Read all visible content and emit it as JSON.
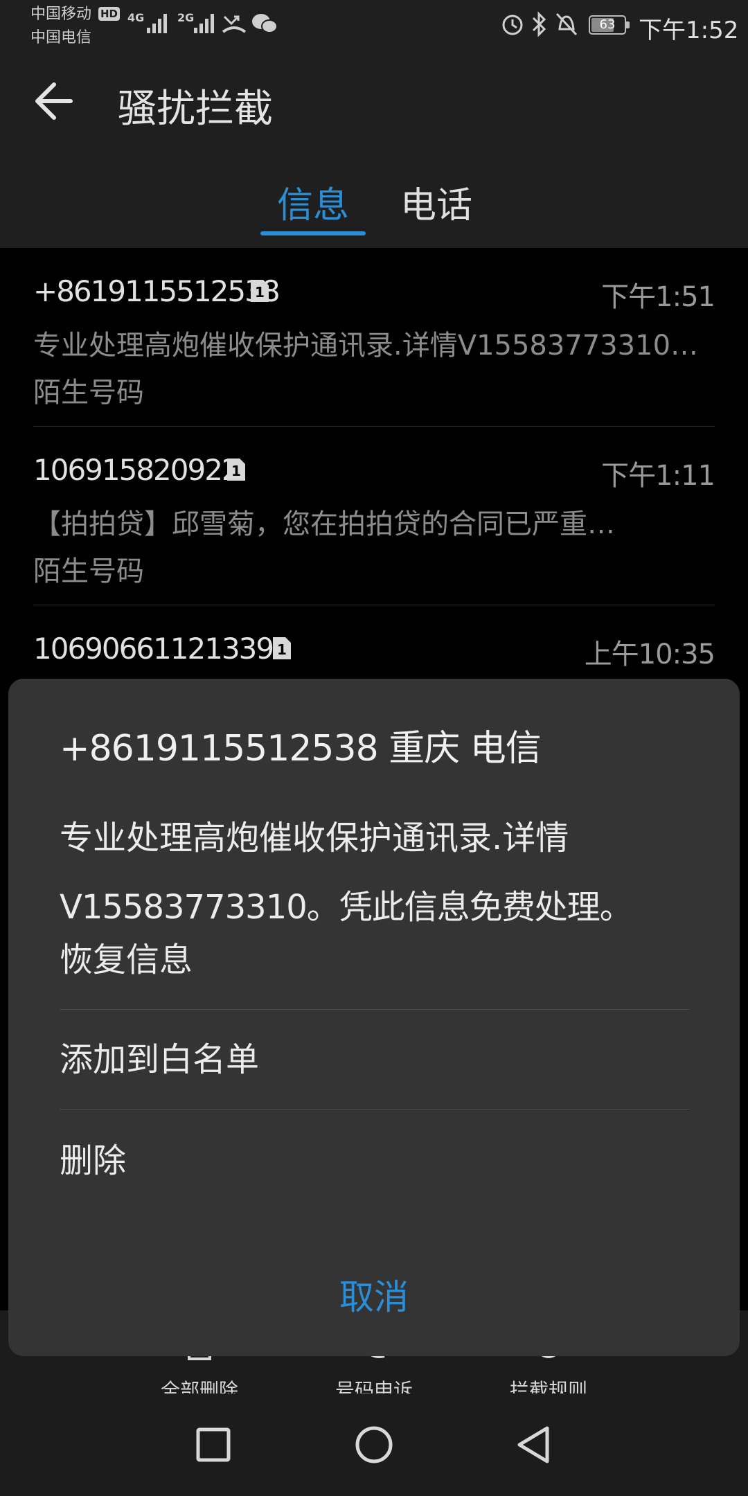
{
  "status_bar": {
    "carrier_1": "中国移动",
    "carrier_2": "中国电信",
    "hd_badge": "HD",
    "network_1": "4G",
    "network_2": "2G",
    "battery": "63",
    "time": "下午1:52"
  },
  "header": {
    "title": "骚扰拦截",
    "tabs": [
      {
        "label": "信息",
        "active": true
      },
      {
        "label": "电话",
        "active": false
      }
    ]
  },
  "messages": [
    {
      "sender": "+8619115512538",
      "time": "下午1:51",
      "preview": "专业处理高炮催收保护通讯录.详情V15583773310…",
      "tag": "陌生号码"
    },
    {
      "sender": "106915820922",
      "time": "下午1:11",
      "preview": "【拍拍贷】邱雪菊，您在拍拍贷的合同已严重…",
      "tag": "陌生号码"
    },
    {
      "sender": "106906611213392",
      "time": "上午10:35",
      "preview": "",
      "tag": ""
    }
  ],
  "toolbar": {
    "items": [
      {
        "label": "全部删除",
        "icon": "trash-icon"
      },
      {
        "label": "号码申诉",
        "icon": "appeal-icon"
      },
      {
        "label": "拦截规则",
        "icon": "rules-icon"
      }
    ]
  },
  "dialog": {
    "title": "+8619115512538 重庆 电信",
    "body_line_1": "专业处理高炮催收保护通讯录.详情",
    "body_line_2": "V15583773310。凭此信息免费处理。",
    "actions": [
      "恢复信息",
      "添加到白名单",
      "删除"
    ],
    "cancel": "取消"
  },
  "colors": {
    "accent": "#2b8fd8",
    "dialog_bg": "#343434",
    "header_bg": "#1f1f1f"
  }
}
